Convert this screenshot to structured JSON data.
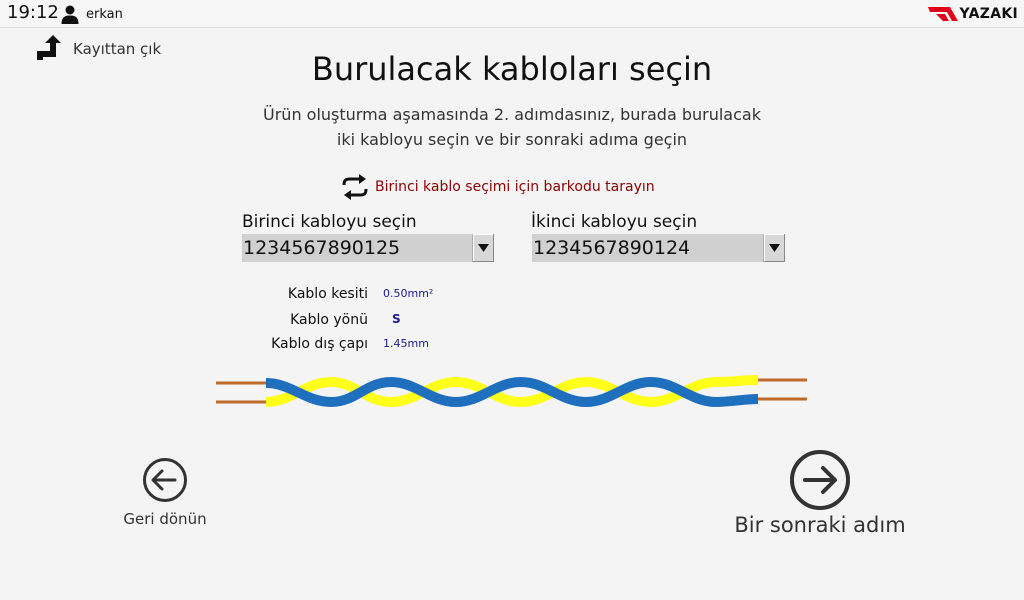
{
  "status_bar": {
    "time": "19:12",
    "username": "erkan",
    "brand": "YAZAKI"
  },
  "logout": {
    "label": "Kayıttan çık"
  },
  "page": {
    "title": "Burulacak kabloları seçin",
    "subtitle_line1": "Ürün oluşturma aşamasında 2. adımdasınız, burada burulacak",
    "subtitle_line2": "iki kabloyu seçin ve bir sonraki adıma geçin"
  },
  "scan_hint": {
    "text": "Birinci kablo seçimi için barkodu tarayın"
  },
  "first_cable": {
    "label": "Birinci kabloyu seçin",
    "value": "1234567890125"
  },
  "second_cable": {
    "label": "İkinci kabloyu seçin",
    "value": "1234567890124"
  },
  "specs": [
    {
      "label": "Kablo kesiti",
      "value": "0.50mm²"
    },
    {
      "label": "Kablo yönü",
      "value": "S"
    },
    {
      "label": "Kablo dış çapı",
      "value": "1.45mm"
    }
  ],
  "navigation": {
    "back_label": "Geri dönün",
    "next_label": "Bir sonraki adım"
  },
  "colors": {
    "wire_blue": "#1f6fbf",
    "wire_yellow": "#ffff1a",
    "copper": "#c06a2a",
    "brand_red": "#e3001b",
    "hint_red": "#8b0000",
    "spec_value": "#1a1a8c"
  }
}
